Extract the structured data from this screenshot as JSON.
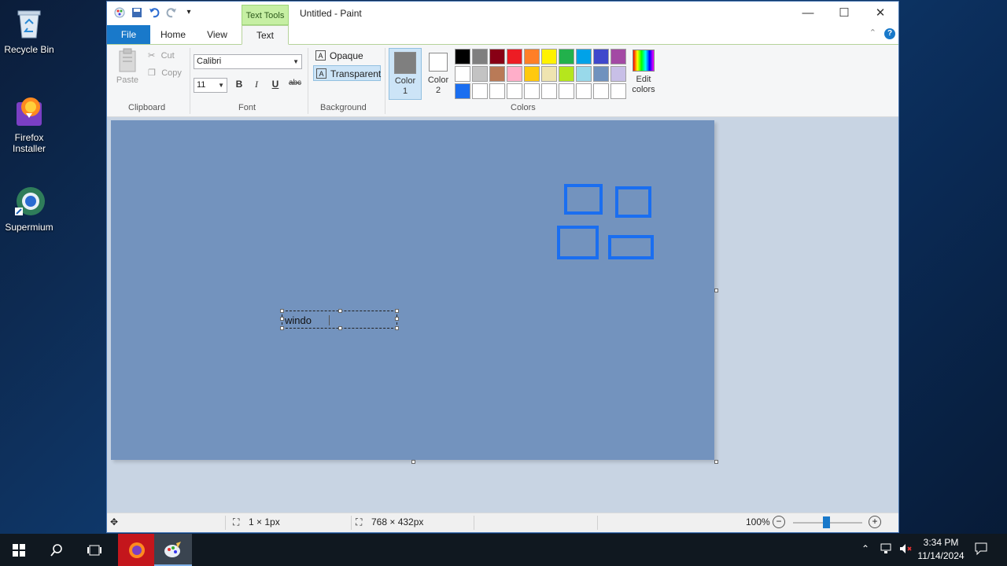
{
  "desktop": {
    "icons": [
      {
        "label": "Recycle Bin"
      },
      {
        "label": "Firefox Installer"
      },
      {
        "label": "Supermium"
      }
    ]
  },
  "window": {
    "contextual_tab": "Text Tools",
    "title": "Untitled - Paint",
    "tabs": {
      "file": "File",
      "home": "Home",
      "view": "View",
      "text": "Text"
    },
    "clipboard": {
      "paste": "Paste",
      "cut": "Cut",
      "copy": "Copy",
      "label": "Clipboard"
    },
    "font": {
      "family": "Calibri",
      "size": "11",
      "bold": "B",
      "italic": "I",
      "underline": "U",
      "strike": "abc",
      "label": "Font"
    },
    "background": {
      "opaque": "Opaque",
      "transparent": "Transparent",
      "label": "Background",
      "selected": "Transparent"
    },
    "colors": {
      "color1_label": "Color\n1",
      "color2_label": "Color\n2",
      "color1": "#7f7f7f",
      "color2": "#ffffff",
      "edit_label": "Edit colors",
      "label": "Colors",
      "palette": [
        "#000000",
        "#7f7f7f",
        "#880015",
        "#ed1c24",
        "#ff7f27",
        "#fff200",
        "#22b14c",
        "#00a2e8",
        "#3f48cc",
        "#a349a4",
        "#ffffff",
        "#c3c3c3",
        "#b97a57",
        "#ffaec9",
        "#ffc90e",
        "#efe4b0",
        "#b5e61d",
        "#99d9ea",
        "#7092be",
        "#c8bfe7",
        "#1a6ef0",
        "#ffffff",
        "#ffffff",
        "#ffffff",
        "#ffffff",
        "#ffffff",
        "#ffffff",
        "#ffffff",
        "#ffffff",
        "#ffffff"
      ]
    },
    "canvas": {
      "bg_color": "#7393be",
      "typed_text": "windo",
      "shape_color": "#1a6ef0"
    },
    "status": {
      "selection": "1 × 1px",
      "image_size": "768 × 432px",
      "zoom": "100%"
    }
  },
  "taskbar": {
    "time": "3:34 PM",
    "date": "11/14/2024"
  }
}
